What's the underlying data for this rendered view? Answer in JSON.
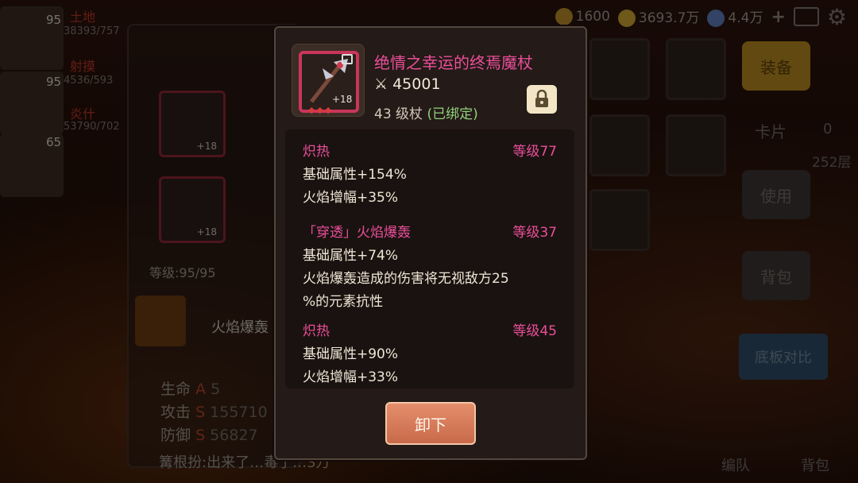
{
  "topbar": {
    "currency1": "1600",
    "currency2": "3693.7万",
    "currency3": "4.4万"
  },
  "party": [
    {
      "level": "95",
      "name": "土地",
      "hp": "38393/757"
    },
    {
      "level": "95",
      "name": "射摸",
      "hp": "4536/593"
    },
    {
      "level": "65",
      "name": "炎什",
      "hp": "53790/702"
    }
  ],
  "left_panel": {
    "level_label": "等级:95/95",
    "skill_label": "火焰爆轰",
    "stats": [
      {
        "name": "生命",
        "grade": "A",
        "value": "5"
      },
      {
        "name": "攻击",
        "grade": "S",
        "value": "155710"
      },
      {
        "name": "防御",
        "grade": "S",
        "value": "56827"
      }
    ],
    "slot1_plus": "+18",
    "slot2_plus": "+18",
    "chat": "篝根扮:出来了…毒了…3万"
  },
  "right_panel": {
    "equip_btn": "装备",
    "card_btn": "卡片",
    "card_count": "0",
    "use_btn": "使用",
    "bag_btn": "背包",
    "compare_btn": "底板对比",
    "floor_text": "252层",
    "bottom_bag": "背包",
    "bottom_team": "编队"
  },
  "item": {
    "name": "绝情之幸运的终焉魔杖",
    "power": "45001",
    "level": "43",
    "type": "级杖",
    "bound": "(已绑定)",
    "plus": "+18"
  },
  "affixes": [
    {
      "name": "炽热",
      "level": "等级77",
      "lines": [
        "基础属性+154%",
        "火焰增幅+35%"
      ]
    },
    {
      "name": "「穿透」火焰爆轰",
      "level": "等级37",
      "lines": [
        "基础属性+74%",
        "火焰爆轰造成的伤害将无视敌方25",
        "%的元素抗性"
      ]
    },
    {
      "name": "炽热",
      "level": "等级45",
      "lines": [
        "基础属性+90%",
        "火焰增幅+33%"
      ]
    }
  ],
  "unequip_button": "卸下",
  "colors": {
    "affix_name": "#e94f9a",
    "bound": "#8fd17c",
    "button": "#d97a56"
  }
}
